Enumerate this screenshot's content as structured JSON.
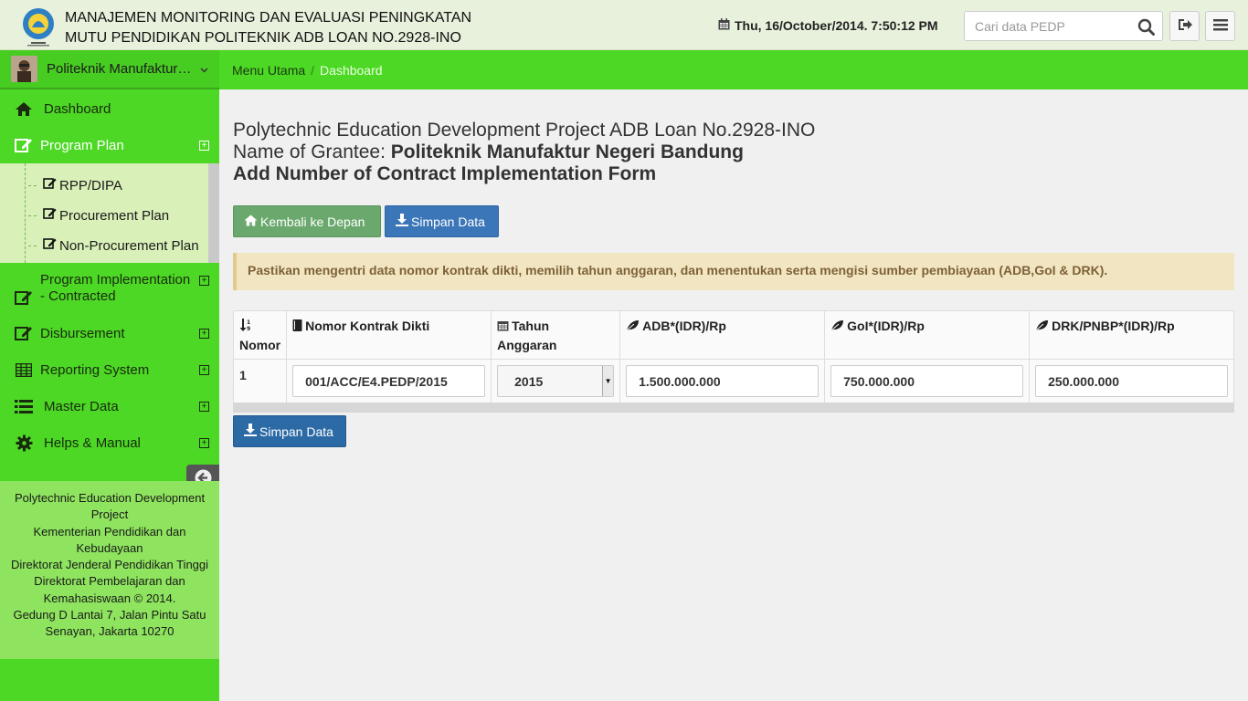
{
  "header": {
    "title_line1": "MANAJEMEN MONITORING DAN EVALUASI PENINGKATAN",
    "title_line2": "MUTU PENDIDIKAN POLITEKNIK ADB LOAN NO.2928-INO",
    "datetime": "Thu, 16/October/2014. 7:50:12 PM",
    "search_placeholder": "Cari data PEDP"
  },
  "user": {
    "name": "Politeknik Manufaktur Negeri Bandung"
  },
  "breadcrumb": {
    "home": "Menu Utama",
    "current": "Dashboard"
  },
  "sidebar": {
    "items": [
      {
        "label": "Dashboard",
        "icon": "home-icon"
      },
      {
        "label": "Program Plan",
        "icon": "edit-icon"
      },
      {
        "label_line1": "Program Implementation",
        "label_line2": "- Contracted",
        "icon": "edit-icon"
      },
      {
        "label": "Disbursement",
        "icon": "edit-icon"
      },
      {
        "label": "Reporting System",
        "icon": "table-icon"
      },
      {
        "label": "Master Data",
        "icon": "list-icon"
      },
      {
        "label": "Helps & Manual",
        "icon": "gear-icon"
      }
    ],
    "subitems": [
      {
        "label": "RPP/DIPA"
      },
      {
        "label": "Procurement Plan"
      },
      {
        "label": "Non-Procurement Plan"
      }
    ],
    "footer": {
      "line1": "Polytechnic Education Development Project",
      "line2": "Kementerian Pendidikan dan Kebudayaan",
      "line3": "Direktorat Jenderal Pendidikan Tinggi",
      "line4": "Direktorat Pembelajaran dan Kemahasiswaan © 2014.",
      "line5": "Gedung D Lantai 7, Jalan Pintu Satu Senayan, Jakarta 10270"
    }
  },
  "main": {
    "title_line1": "Polytechnic Education Development Project ADB Loan No.2928-INO",
    "grantee_prefix": "Name of Grantee: ",
    "grantee_name": "Politeknik Manufaktur Negeri Bandung",
    "form_title": "Add Number of Contract Implementation Form",
    "btn_back": "Kembali ke Depan",
    "btn_save": "Simpan Data",
    "alert": "Pastikan mengentri data nomor kontrak dikti, memilih tahun anggaran, dan menentukan serta mengisi sumber pembiayaan (ADB,GoI & DRK).",
    "table": {
      "headers": {
        "nomor": "Nomor",
        "kontrak": "Nomor Kontrak Dikti",
        "tahun_line1": "Tahun",
        "tahun_line2": "Anggaran",
        "adb": "ADB*(IDR)/Rp",
        "goi": "GoI*(IDR)/Rp",
        "drk": "DRK/PNBP*(IDR)/Rp"
      },
      "row": {
        "nomor": "1",
        "kontrak": "001/ACC/E4.PEDP/2015",
        "tahun": "2015",
        "adb": "1.500.000.000",
        "goi": "750.000.000",
        "drk": "250.000.000"
      }
    }
  },
  "colors": {
    "green": "#4cd824",
    "header_bg": "#e8f1dc",
    "primary": "#3b76b8",
    "success": "#6aa86d"
  }
}
